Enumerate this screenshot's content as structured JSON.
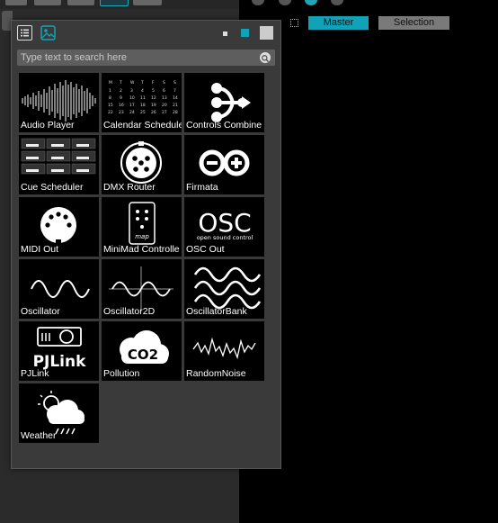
{
  "window": {
    "tabs": [
      {
        "label": "Master",
        "active": true
      },
      {
        "label": "Selection",
        "active": false
      }
    ],
    "accent_color": "#12a2b8"
  },
  "popup": {
    "view_modes": [
      "list-icon",
      "image-grid-icon"
    ],
    "size_options": [
      "small",
      "medium",
      "large"
    ],
    "selected_size": "medium",
    "search": {
      "placeholder": "Type text to search here",
      "value": ""
    },
    "modules": [
      {
        "label": "Audio Player",
        "icon": "waveform-icon"
      },
      {
        "label": "Calendar Schedule",
        "icon": "calendar-icon"
      },
      {
        "label": "Controls Combine",
        "icon": "controls-combine-icon"
      },
      {
        "label": "Cue Scheduler",
        "icon": "cue-grid-icon"
      },
      {
        "label": "DMX Router",
        "icon": "xlr-connector-icon"
      },
      {
        "label": "Firmata",
        "icon": "infinity-plus-icon"
      },
      {
        "label": "MIDI Out",
        "icon": "midi-connector-icon"
      },
      {
        "label": "MiniMad Controlle",
        "icon": "minimad-remote-icon"
      },
      {
        "label": "OSC Out",
        "icon": "osc-logo-icon"
      },
      {
        "label": "Oscillator",
        "icon": "sine-wave-icon"
      },
      {
        "label": "Oscillator2D",
        "icon": "sine-axes-icon"
      },
      {
        "label": "OscillatorBank",
        "icon": "multi-wave-icon"
      },
      {
        "label": "PJLink",
        "icon": "projector-icon"
      },
      {
        "label": "Pollution",
        "icon": "co2-cloud-icon"
      },
      {
        "label": "RandomNoise",
        "icon": "noise-wave-icon"
      },
      {
        "label": "Weather",
        "icon": "weather-cloud-icon"
      }
    ],
    "icon_text": {
      "osc_big": "OSC",
      "osc_small": "open sound control",
      "co2": "CO2",
      "pjlink": "PJLink",
      "madmap": "map"
    }
  }
}
